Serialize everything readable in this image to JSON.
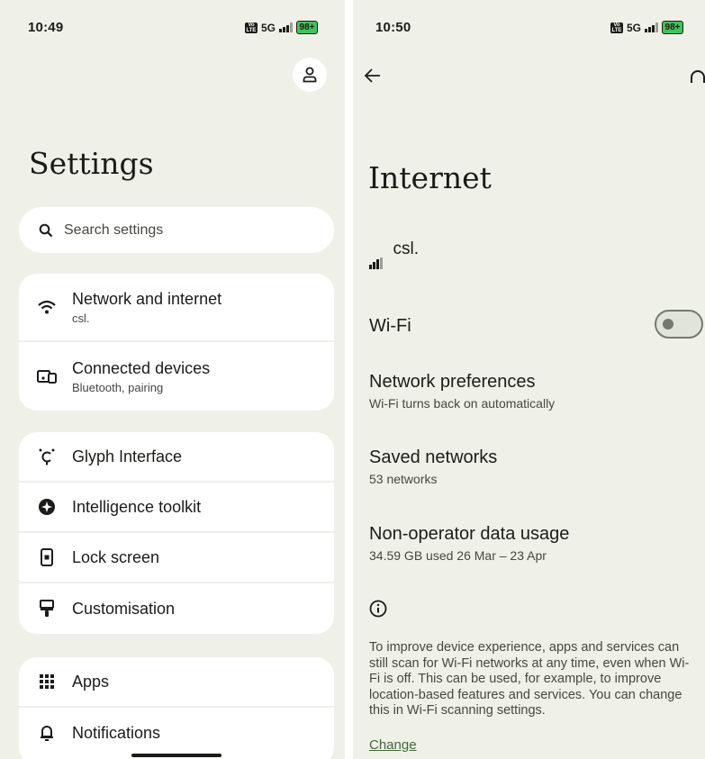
{
  "left": {
    "status": {
      "time": "10:49",
      "network": "5G",
      "battery": "98+"
    },
    "title": "Settings",
    "search_placeholder": "Search settings",
    "groups": [
      [
        {
          "icon": "wifi-icon",
          "label": "Network and internet",
          "sub": "csl."
        },
        {
          "icon": "devices-icon",
          "label": "Connected devices",
          "sub": "Bluetooth, pairing"
        }
      ],
      [
        {
          "icon": "glyph-icon",
          "label": "Glyph Interface"
        },
        {
          "icon": "sparkle-icon",
          "label": "Intelligence toolkit"
        },
        {
          "icon": "lock-icon",
          "label": "Lock screen"
        },
        {
          "icon": "brush-icon",
          "label": "Customisation"
        }
      ],
      [
        {
          "icon": "apps-icon",
          "label": "Apps"
        },
        {
          "icon": "bell-icon",
          "label": "Notifications"
        }
      ]
    ]
  },
  "right": {
    "status": {
      "time": "10:50",
      "network": "5G",
      "battery": "98+"
    },
    "title": "Internet",
    "carrier": "csl.",
    "wifi_label": "Wi-Fi",
    "wifi_on": false,
    "network_prefs": {
      "label": "Network preferences",
      "sub": "Wi-Fi turns back on automatically"
    },
    "saved_networks": {
      "label": "Saved networks",
      "sub": "53 networks"
    },
    "data_usage": {
      "label": "Non-operator data usage",
      "sub": "34.59 GB used 26 Mar – 23 Apr"
    },
    "info": "To improve device experience, apps and services can still scan for Wi-Fi networks at any time, even when Wi-Fi is off. This can be used, for example, to improve location-based features and services. You can change this in Wi-Fi scanning settings.",
    "change_link": "Change"
  }
}
